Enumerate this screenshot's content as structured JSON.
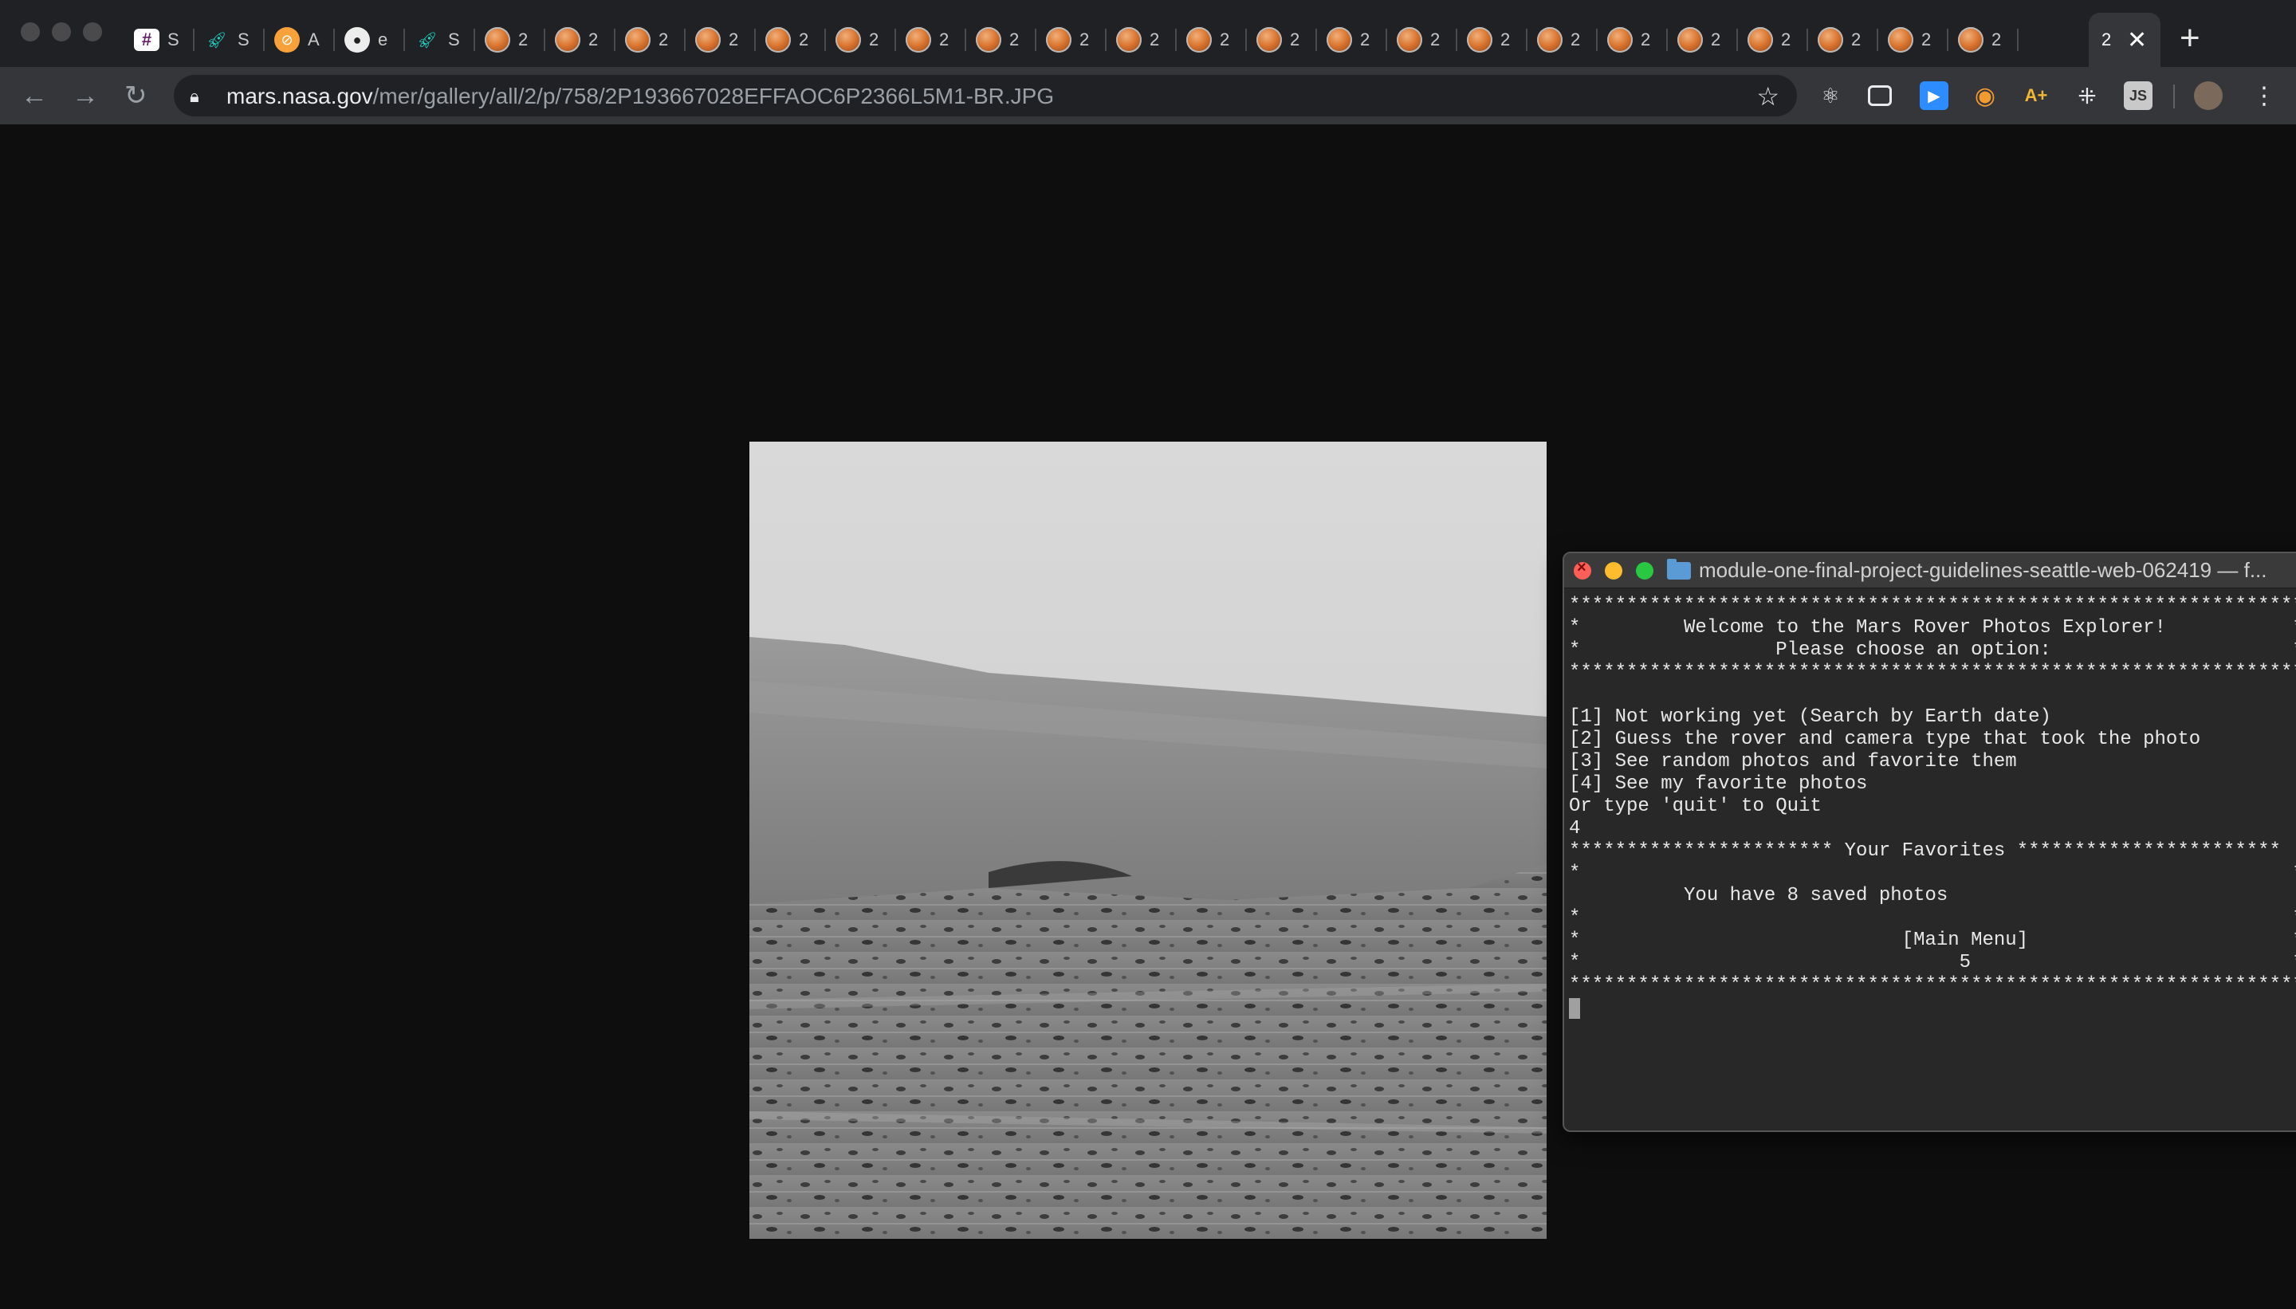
{
  "browser": {
    "tabs": [
      {
        "icon": "slack-icon",
        "title": "S"
      },
      {
        "icon": "rocket-icon",
        "title": "S"
      },
      {
        "icon": "compass-icon",
        "title": "A"
      },
      {
        "icon": "github-icon",
        "title": "e"
      },
      {
        "icon": "rocket-icon",
        "title": "S"
      },
      {
        "icon": "mars-icon",
        "title": "2"
      },
      {
        "icon": "mars-icon",
        "title": "2"
      },
      {
        "icon": "mars-icon",
        "title": "2"
      },
      {
        "icon": "mars-icon",
        "title": "2"
      },
      {
        "icon": "mars-icon",
        "title": "2"
      },
      {
        "icon": "mars-icon",
        "title": "2"
      },
      {
        "icon": "mars-icon",
        "title": "2"
      },
      {
        "icon": "mars-icon",
        "title": "2"
      },
      {
        "icon": "mars-icon",
        "title": "2"
      },
      {
        "icon": "mars-icon",
        "title": "2"
      },
      {
        "icon": "mars-icon",
        "title": "2"
      },
      {
        "icon": "mars-icon",
        "title": "2"
      },
      {
        "icon": "mars-icon",
        "title": "2"
      },
      {
        "icon": "mars-icon",
        "title": "2"
      },
      {
        "icon": "mars-icon",
        "title": "2"
      },
      {
        "icon": "mars-icon",
        "title": "2"
      },
      {
        "icon": "mars-icon",
        "title": "2"
      },
      {
        "icon": "mars-icon",
        "title": "2"
      },
      {
        "icon": "mars-icon",
        "title": "2"
      },
      {
        "icon": "mars-icon",
        "title": "2"
      },
      {
        "icon": "mars-icon",
        "title": "2"
      },
      {
        "icon": "mars-icon",
        "title": "2"
      }
    ],
    "active_tab_title": "2",
    "url_host": "mars.nasa.gov",
    "url_path": "/mer/gallery/all/2/p/758/2P193667028EFFAOC6P2366L5M1-BR.JPG",
    "extension_icons": [
      "react-icon",
      "screenshot-icon",
      "zoom-icon",
      "scout-icon",
      "grid-icon",
      "js-icon",
      "avatar-icon",
      "menu-icon"
    ]
  },
  "terminal": {
    "title": "module-one-final-project-guidelines-seattle-web-062419 — f...",
    "lines": [
      "****************************************************************",
      "*         Welcome to the Mars Rover Photos Explorer!           *",
      "*                 Please choose an option:                     *",
      "****************************************************************",
      "",
      "[1] Not working yet (Search by Earth date)",
      "[2] Guess the rover and camera type that took the photo",
      "[3] See random photos and favorite them",
      "[4] See my favorite photos",
      "Or type 'quit' to Quit",
      "4",
      "*********************** Your Favorites ***********************",
      "*                                                              *",
      "          You have 8 saved photos",
      "*                                                              *",
      "*                            [Main Menu]                       *",
      "*                                 5                            *",
      "****************************************************************"
    ]
  },
  "colors": {
    "page_background": "#0e0e0e",
    "tabstrip": "#202124",
    "toolbar": "#35363a",
    "terminal_background": "#282828"
  }
}
